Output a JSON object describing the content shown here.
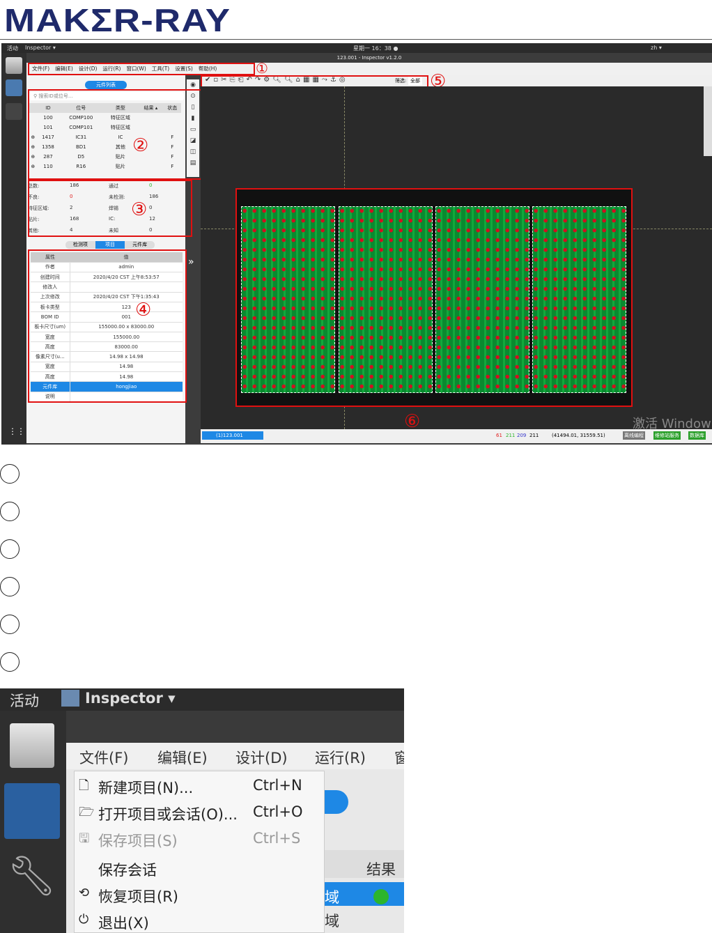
{
  "logo": "MAKΣR-RAY",
  "app": {
    "topbar": {
      "activities": "活动",
      "app_name": "Inspector ▾",
      "clock": "星期一 16：38 ●",
      "lang": "zh ▾"
    },
    "title": "123.001 - Inspector v1.2.0",
    "menus": [
      "文件(F)",
      "编辑(E)",
      "设计(D)",
      "运行(R)",
      "窗口(W)",
      "工具(T)",
      "设置(S)",
      "帮助(H)"
    ],
    "toolbar": {
      "filter_label": "筛选:",
      "filter_value": "全部"
    },
    "component_list_tab": "元件列表",
    "search_placeholder": "搜索ID或位号...",
    "list_headers": [
      "ID",
      "位号",
      "类型",
      "结果 ▴",
      "状态"
    ],
    "list_rows": [
      {
        "expand": "",
        "id": "100",
        "ref": "COMP100",
        "type": "特征区域",
        "status": ""
      },
      {
        "expand": "",
        "id": "101",
        "ref": "COMP101",
        "type": "特征区域",
        "status": ""
      },
      {
        "expand": "⊕",
        "id": "1417",
        "ref": "IC31",
        "type": "IC",
        "status": "F"
      },
      {
        "expand": "⊕",
        "id": "1358",
        "ref": "BD1",
        "type": "其他",
        "status": "F"
      },
      {
        "expand": "⊕",
        "id": "287",
        "ref": "D5",
        "type": "贴片",
        "status": "F"
      },
      {
        "expand": "⊕",
        "id": "110",
        "ref": "R16",
        "type": "贴片",
        "status": "F"
      }
    ],
    "stats": [
      {
        "label": "总数:",
        "value": "186",
        "label2": "通过",
        "value2": "0"
      },
      {
        "label": "不良:",
        "value": "0",
        "label2": "未检测:",
        "value2": "186"
      },
      {
        "label": "特征区域:",
        "value": "2",
        "label2": "焊锡",
        "value2": "0"
      },
      {
        "label": "贴片:",
        "value": "168",
        "label2": "IC:",
        "value2": "12"
      },
      {
        "label": "其他:",
        "value": "4",
        "label2": "未知",
        "value2": "0"
      }
    ],
    "prop_tabs": [
      "检测项",
      "项目",
      "元件库"
    ],
    "prop_headers": [
      "属性",
      "值"
    ],
    "props": [
      [
        "作者",
        "admin"
      ],
      [
        "创建时间",
        "2020/4/20 CST 上午8:53:57"
      ],
      [
        "修改人",
        ""
      ],
      [
        "上次修改",
        "2020/4/20 CST 下午1:35:43"
      ],
      [
        "板卡类型",
        "123"
      ],
      [
        "BOM ID",
        "001"
      ],
      [
        "板卡尺寸(um)",
        "155000.00 x 83000.00"
      ],
      [
        "宽度",
        "155000.00"
      ],
      [
        "高度",
        "83000.00"
      ],
      [
        "像素尺寸(u...",
        "14.98 x 14.98"
      ],
      [
        "宽度",
        "14.98"
      ],
      [
        "高度",
        "14.98"
      ],
      [
        "元件库",
        "hongjiao"
      ],
      [
        "说明",
        ""
      ]
    ],
    "expand_arrow": "»",
    "status": {
      "tab": "(1)123.001",
      "counts": [
        "61",
        "211",
        "209",
        "211"
      ],
      "coords": "(41494.01, 31559.51)",
      "buttons": [
        "离线编程",
        "维修站服务",
        "数据库"
      ]
    },
    "watermark": "激活 Window",
    "callouts": [
      "①",
      "②",
      "③",
      "④",
      "⑤",
      "⑥"
    ]
  },
  "zoom": {
    "activities": "活动",
    "app_name": "Inspector ▾",
    "menus": [
      "文件(F)",
      "编辑(E)",
      "设计(D)",
      "运行(R)",
      "窗"
    ],
    "items": [
      {
        "icon": "🗋",
        "label": "新建项目(N)...",
        "shortcut": "Ctrl+N"
      },
      {
        "icon": "🗁",
        "label": "打开项目或会话(O)...",
        "shortcut": "Ctrl+O"
      },
      {
        "icon": "🖫",
        "label": "保存项目(S)",
        "shortcut": "Ctrl+S"
      },
      {
        "icon": "",
        "label": "保存会话",
        "shortcut": ""
      },
      {
        "icon": "⟲",
        "label": "恢复项目(R)",
        "shortcut": ""
      },
      {
        "icon": "⏻",
        "label": "退出(X)",
        "shortcut": ""
      }
    ],
    "bg_result": "结果 ▴",
    "bg_text1": "域",
    "bg_text2": "域"
  }
}
